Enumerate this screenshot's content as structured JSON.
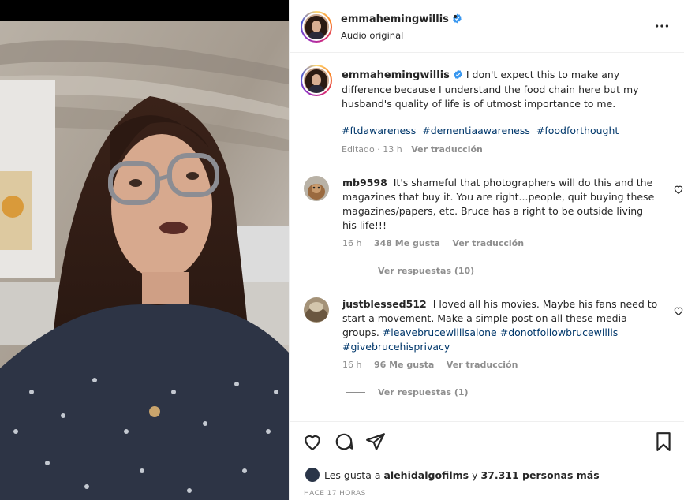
{
  "post": {
    "username": "emmahemingwillis",
    "audio": "Audio original",
    "dot": "•"
  },
  "caption": {
    "username": "emmahemingwillis",
    "text": "I don't expect this to make any difference because I understand the food chain here but my husband's quality of life is of utmost importance to me.",
    "hashtags": [
      "#ftdawareness",
      "#dementiaawareness",
      "#foodforthought"
    ],
    "edited": "Editado · 13 h",
    "translate": "Ver traducción"
  },
  "comments": [
    {
      "username": "mb9598",
      "text": "It's shameful that photographers will do this and the magazines that buy it. You are right...people, quit buying these magazines/papers, etc. Bruce has a right to be outside living his life!!!",
      "tags": [],
      "time": "16 h",
      "likes": "348 Me gusta",
      "translate": "Ver traducción",
      "replies": "Ver respuestas (10)"
    },
    {
      "username": "justblessed512",
      "text": "I loved all his movies. Maybe his fans need to start a movement. Make a simple post on all these media groups.",
      "tags": [
        "#leavebrucewillisalone",
        "#donotfollowbrucewillis",
        "#givebrucehisprivacy"
      ],
      "time": "16 h",
      "likes": "96 Me gusta",
      "translate": "Ver traducción",
      "replies": "Ver respuestas (1)"
    }
  ],
  "likes": {
    "prefix": "Les gusta a",
    "user": "alehidalgofilms",
    "middle": "y",
    "others": "37.311 personas más"
  },
  "posted": "HACE 17 HORAS",
  "colors": {
    "link": "#00376b",
    "muted": "#8e8e8e",
    "verified": "#3897f0"
  },
  "icons": [
    "more-options-icon",
    "heart-icon",
    "comment-icon",
    "share-icon",
    "bookmark-icon",
    "verified-badge-icon"
  ]
}
